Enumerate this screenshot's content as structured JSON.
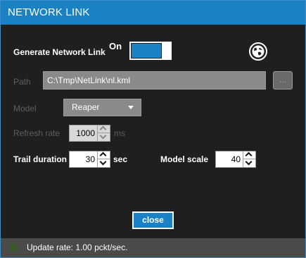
{
  "window": {
    "title": "NETWORK LINK"
  },
  "generate": {
    "label": "Generate Network Link",
    "state": "On",
    "enabled": true
  },
  "icons": {
    "globe": "globe-icon",
    "browse": "ellipsis-icon"
  },
  "path": {
    "label": "Path",
    "value": "C:\\Tmp\\NetLink\\nl.kml",
    "browse_label": "..."
  },
  "model": {
    "label": "Model",
    "value": "Reaper"
  },
  "refresh": {
    "label": "Refresh rate",
    "value": "1000",
    "unit": "ms"
  },
  "trail": {
    "label": "Trail duration",
    "value": "30",
    "unit": "sec"
  },
  "scale": {
    "label": "Model scale",
    "value": "40"
  },
  "actions": {
    "close_label": "close"
  },
  "status": {
    "text": "Update rate: 1.00 pckt/sec."
  },
  "colors": {
    "accent": "#1a82c4",
    "background": "#1f1f1f",
    "status_bar": "#4a4a4a"
  }
}
